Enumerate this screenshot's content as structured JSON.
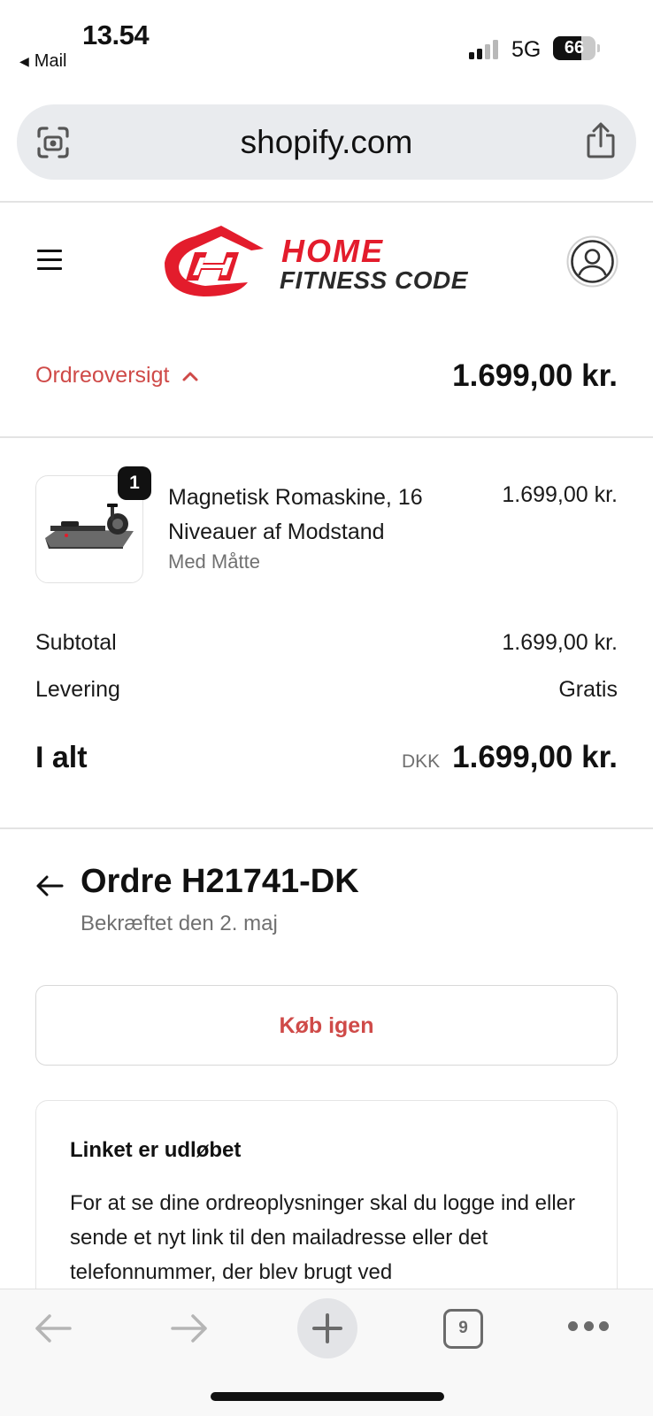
{
  "status_bar": {
    "time": "13.54",
    "back_app": "Mail",
    "network": "5G",
    "battery": "66",
    "battery_level": 0.66
  },
  "browser": {
    "url": "shopify.com",
    "tab_count": "9"
  },
  "store": {
    "logo_line1": "HOME",
    "logo_line2": "FITNESS CODE",
    "brand_color": "#e31c2c"
  },
  "summary": {
    "toggle_label": "Ordreoversigt",
    "total": "1.699,00 kr.",
    "accent_color": "#cf4a48"
  },
  "product": {
    "quantity": "1",
    "name": "Magnetisk Romaskine, 16 Niveauer af Modstand",
    "variant": "Med Måtte",
    "price": "1.699,00 kr."
  },
  "totals": {
    "subtotal_label": "Subtotal",
    "subtotal_value": "1.699,00 kr.",
    "shipping_label": "Levering",
    "shipping_value": "Gratis",
    "total_label": "I alt",
    "currency": "DKK",
    "total_value": "1.699,00 kr."
  },
  "order": {
    "title": "Ordre H21741-DK",
    "subtitle": "Bekræftet den 2. maj",
    "buy_again_label": "Køb igen"
  },
  "notice": {
    "title": "Linket er udløbet",
    "body": "For at se dine ordreoplysninger skal du logge ind eller sende et nyt link til den mailadresse eller det telefonnummer, der blev brugt ved"
  }
}
